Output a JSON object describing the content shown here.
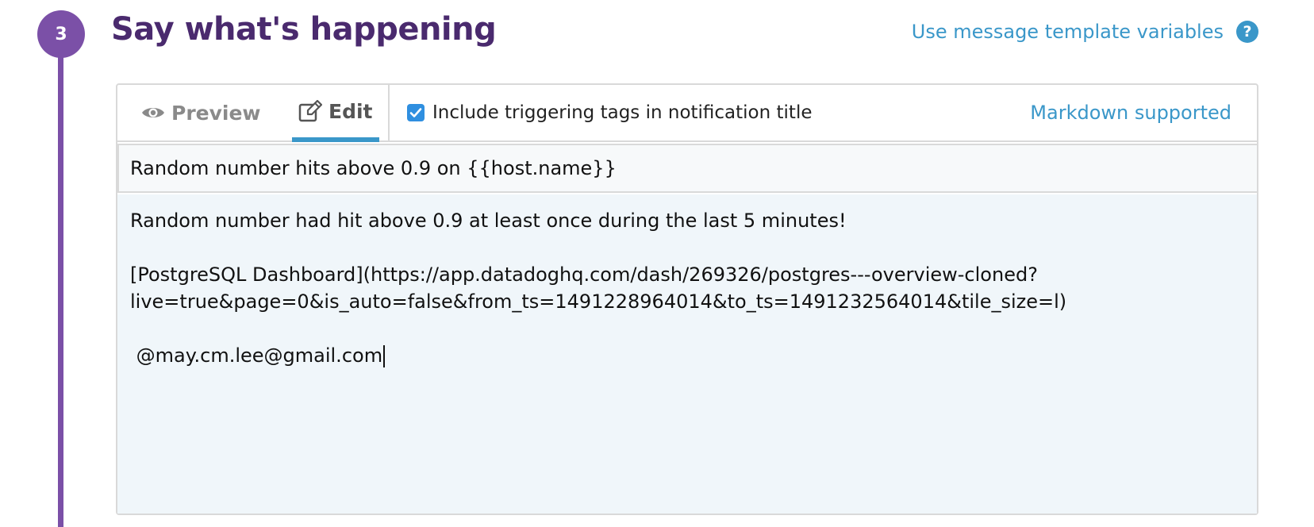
{
  "step": {
    "number": "3",
    "title": "Say what's happening"
  },
  "help": {
    "link_label": "Use message template variables",
    "icon": "question-circle-icon",
    "icon_glyph": "?"
  },
  "tabs": [
    {
      "label": "Preview",
      "icon": "eye-icon",
      "active": false
    },
    {
      "label": "Edit",
      "icon": "edit-icon",
      "active": true
    }
  ],
  "options": {
    "include_tags_label": "Include triggering tags in notification title",
    "include_tags_checked": true
  },
  "markdown_label": "Markdown supported",
  "message": {
    "title_value": "Random number hits above 0.9 on {{host.name}}",
    "body_lines": [
      "Random number had hit above 0.9 at least once during the last 5 minutes!",
      "",
      "[PostgreSQL Dashboard](https://app.datadoghq.com/dash/269326/postgres---overview-cloned?",
      "live=true&page=0&is_auto=false&from_ts=1491228964014&to_ts=1491232564014&tile_size=l)",
      "",
      " @may.cm.lee@gmail.com"
    ]
  },
  "colors": {
    "accent_purple": "#7b50a7",
    "title_purple": "#4a2a6e",
    "link_blue": "#3a97c9",
    "checkbox_blue": "#2f8fe0",
    "textarea_bg": "#f0f6fa"
  }
}
